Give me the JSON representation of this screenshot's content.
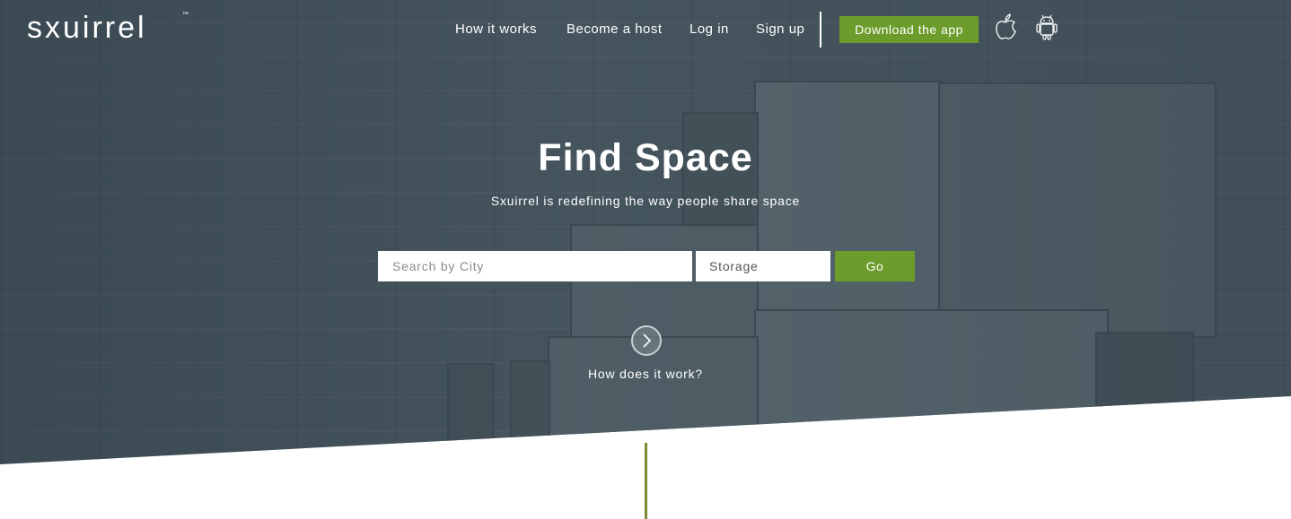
{
  "brand": {
    "logo_text": "sxuirrel",
    "trademark": "™"
  },
  "nav": {
    "links": [
      {
        "label": "How it works"
      },
      {
        "label": "Become a host"
      },
      {
        "label": "Log in"
      },
      {
        "label": "Sign up"
      }
    ],
    "download_label": "Download the app",
    "store_icons": [
      "apple-icon",
      "android-icon"
    ]
  },
  "hero": {
    "title": "Find Space",
    "subtitle": "Sxuirrel is redefining the way people share space"
  },
  "search": {
    "city_placeholder": "Search by City",
    "city_value": "",
    "type_value": "Storage",
    "go_label": "Go"
  },
  "how": {
    "label": "How does it work?",
    "icon": "chevron-right-icon"
  },
  "colors": {
    "accent": "#6c9c2b",
    "hero_bg": "#4a5962",
    "divider_line": "#7d8b2e"
  }
}
